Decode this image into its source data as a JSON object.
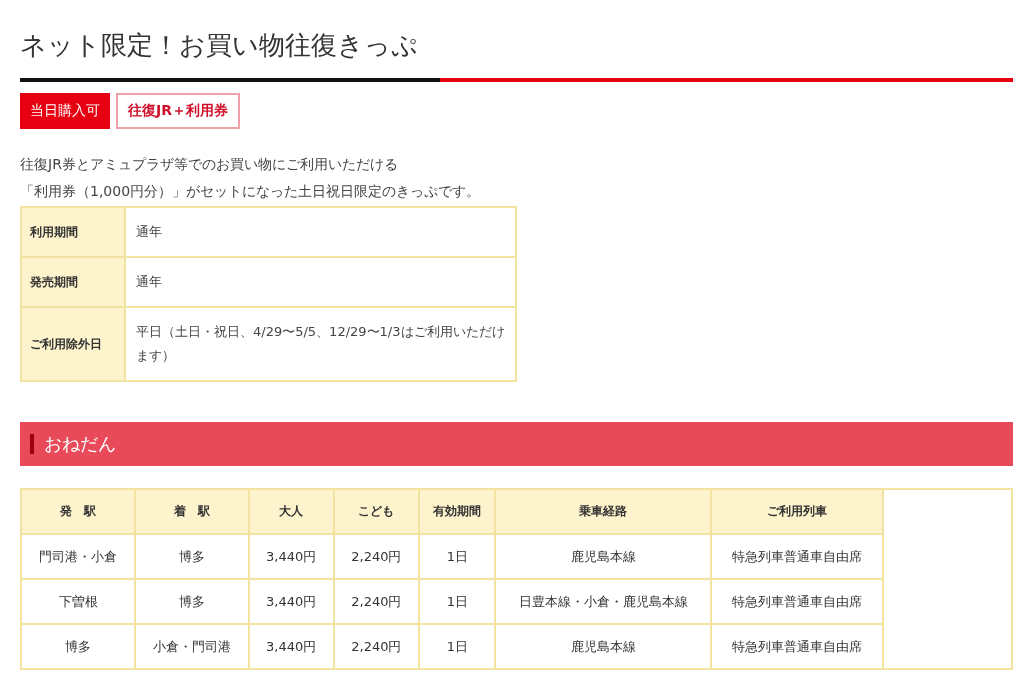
{
  "title": "ネット限定！お買い物往復きっぷ",
  "badges": [
    {
      "label": "当日購入可",
      "kind": "filled"
    },
    {
      "label": "往復JR＋利用券",
      "kind": "outline"
    }
  ],
  "description": [
    "往復JR券とアミュプラザ等でのお買い物にご利用いただける",
    "「利用券（1,000円分）」がセットになった土日祝日限定のきっぷです。"
  ],
  "info_table": [
    {
      "label": "利用期間",
      "value": "通年"
    },
    {
      "label": "発売期間",
      "value": "通年"
    },
    {
      "label": "ご利用除外日",
      "value": "平日（土日・祝日、4/29〜5/5、12/29〜1/3はご利用いただけます）"
    }
  ],
  "section_heading": "おねだん",
  "price_table": {
    "columns": [
      "発　駅",
      "着　駅",
      "大人",
      "こども",
      "有効期間",
      "乗車経路",
      "ご利用列車"
    ],
    "rows": [
      [
        "門司港・小倉",
        "博多",
        "3,440円",
        "2,240円",
        "1日",
        "鹿児島本線",
        "特急列車普通車自由席"
      ],
      [
        "下曽根",
        "博多",
        "3,440円",
        "2,240円",
        "1日",
        "日豊本線・小倉・鹿児島本線",
        "特急列車普通車自由席"
      ],
      [
        "博多",
        "小倉・門司港",
        "3,440円",
        "2,240円",
        "1日",
        "鹿児島本線",
        "特急列車普通車自由席"
      ]
    ]
  }
}
